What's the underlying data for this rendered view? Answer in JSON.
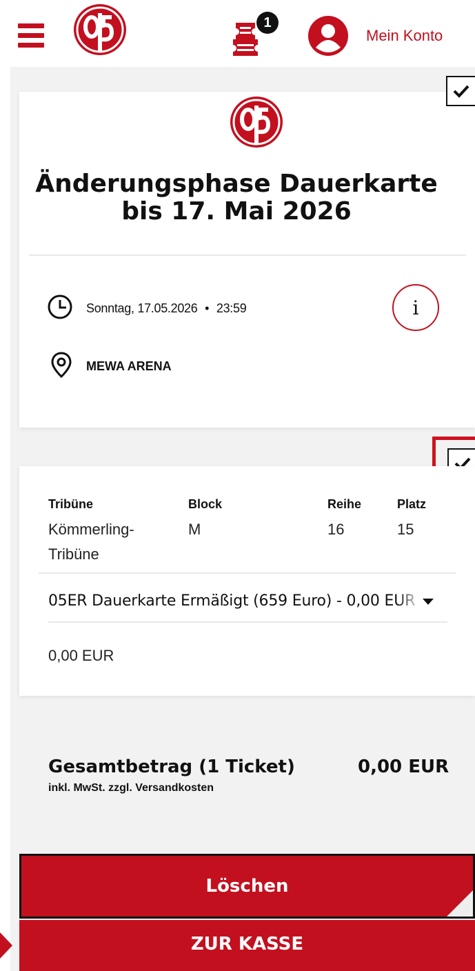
{
  "header": {
    "cart_count": "1",
    "account_label": "Mein Konto"
  },
  "event": {
    "title_line1": "Änderungsphase Dauerkarte",
    "title_line2": "bis 17. Mai 2026",
    "date": "Sonntag, 17.05.2026",
    "separator": "•",
    "time": "23:59",
    "venue": "MEWA ARENA",
    "info_label": "i"
  },
  "ticket": {
    "columns": [
      {
        "header": "Tribüne",
        "value_line1": "Kömmerling-",
        "value_line2": "Tribüne"
      },
      {
        "header": "Block",
        "value_line1": "M",
        "value_line2": ""
      },
      {
        "header": "Reihe",
        "value_line1": "16",
        "value_line2": ""
      },
      {
        "header": "Platz",
        "value_line1": "15",
        "value_line2": ""
      }
    ],
    "price_category": "05ER Dauerkarte Ermäßigt (659 Euro) - 0,00 EUR",
    "price": "0,00 EUR"
  },
  "totals": {
    "label": "Gesamtbetrag (1 Ticket)",
    "sub_label": "inkl. MwSt. zzgl. Versandkosten",
    "value": "0,00 EUR"
  },
  "buttons": {
    "delete_label": "Löschen",
    "checkout_label": "ZUR KASSE"
  },
  "colors": {
    "brand_red": "#c3101f",
    "highlight_red": "#d0101f",
    "background_gray": "#f2f2f2"
  },
  "icons": {
    "menu": "hamburger-icon",
    "logo": "club-logo",
    "cart": "ticket-cart-icon",
    "account": "user-icon",
    "clock": "clock-icon",
    "location": "location-pin-icon",
    "info": "info-icon",
    "check": "checkmark-icon"
  }
}
